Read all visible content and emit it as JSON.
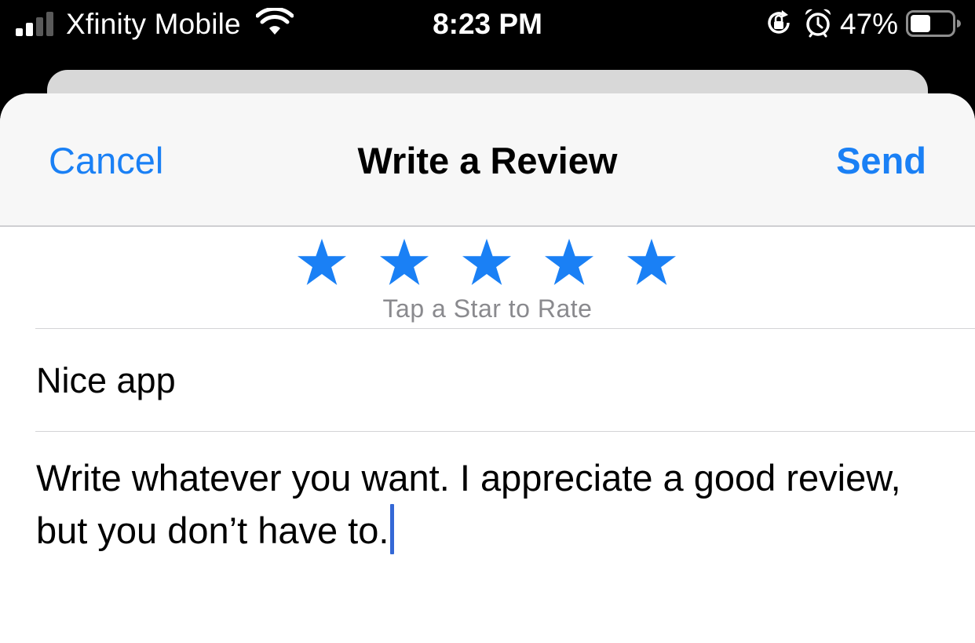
{
  "status_bar": {
    "carrier": "Xfinity Mobile",
    "time": "8:23 PM",
    "battery_percent": "47%",
    "signal_bars_active": 2,
    "battery_level": 0.47,
    "icons": [
      "signal-icon",
      "wifi-icon",
      "rotation-lock-icon",
      "alarm-icon",
      "battery-icon"
    ]
  },
  "nav": {
    "cancel_label": "Cancel",
    "title": "Write a Review",
    "send_label": "Send"
  },
  "rating": {
    "star_count": 5,
    "hint": "Tap a Star to Rate",
    "star_color": "#1a80f5"
  },
  "review": {
    "title_value": "Nice app",
    "body_value": "Write whatever you want. I appreciate a good review, but you don’t have to."
  },
  "colors": {
    "accent": "#1a80f5",
    "caret": "#3468d6",
    "hint_gray": "#8a8a8e"
  }
}
